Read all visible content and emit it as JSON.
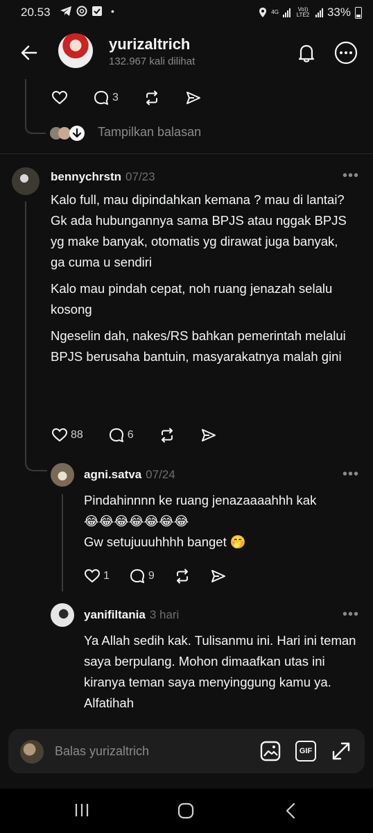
{
  "status_bar": {
    "time": "20.53",
    "battery": "33%",
    "network_1": "4G",
    "network_2": "Vo)) LTE2"
  },
  "header": {
    "username": "yurizaltrich",
    "views": "132.967 kali dilihat"
  },
  "top_post": {
    "reply_count": "3",
    "show_replies": "Tampilkan balasan"
  },
  "comments": [
    {
      "username": "bennychrstn",
      "date": "07/23",
      "paragraphs": [
        "Kalo full, mau dipindahkan kemana ? mau di lantai?\nGk ada hubungannya sama BPJS atau nggak BPJS yg make banyak, otomatis yg dirawat juga banyak, ga cuma u sendiri",
        "Kalo mau pindah cepat, noh ruang jenazah selalu kosong",
        "Ngeselin dah, nakes/RS bahkan pemerintah melalui BPJS berusaha bantuin, masyarakatnya malah gini"
      ],
      "likes": "88",
      "replies": "6"
    },
    {
      "username": "agni.satva",
      "date": "07/24",
      "paragraphs": [
        "Pindahinnnn ke ruang jenazaaaahhh kak\n😂😂😂😂😂😂😂\nGw setujuuuhhhh banget 🤭"
      ],
      "likes": "1",
      "replies": "9"
    },
    {
      "username": "yanifiltania",
      "date": "3 hari",
      "paragraphs": [
        "Ya Allah sedih kak. Tulisanmu ini. Hari ini teman saya berpulang. Mohon dimaafkan utas ini kiranya teman saya menyinggung kamu ya. Alfatihah"
      ]
    }
  ],
  "reply_bar": {
    "placeholder": "Balas yurizaltrich"
  },
  "icons": {
    "gif_label": "GIF"
  },
  "colors": {
    "background": "#101010",
    "text": "#f3f5f7",
    "muted": "#8a8a8a"
  }
}
